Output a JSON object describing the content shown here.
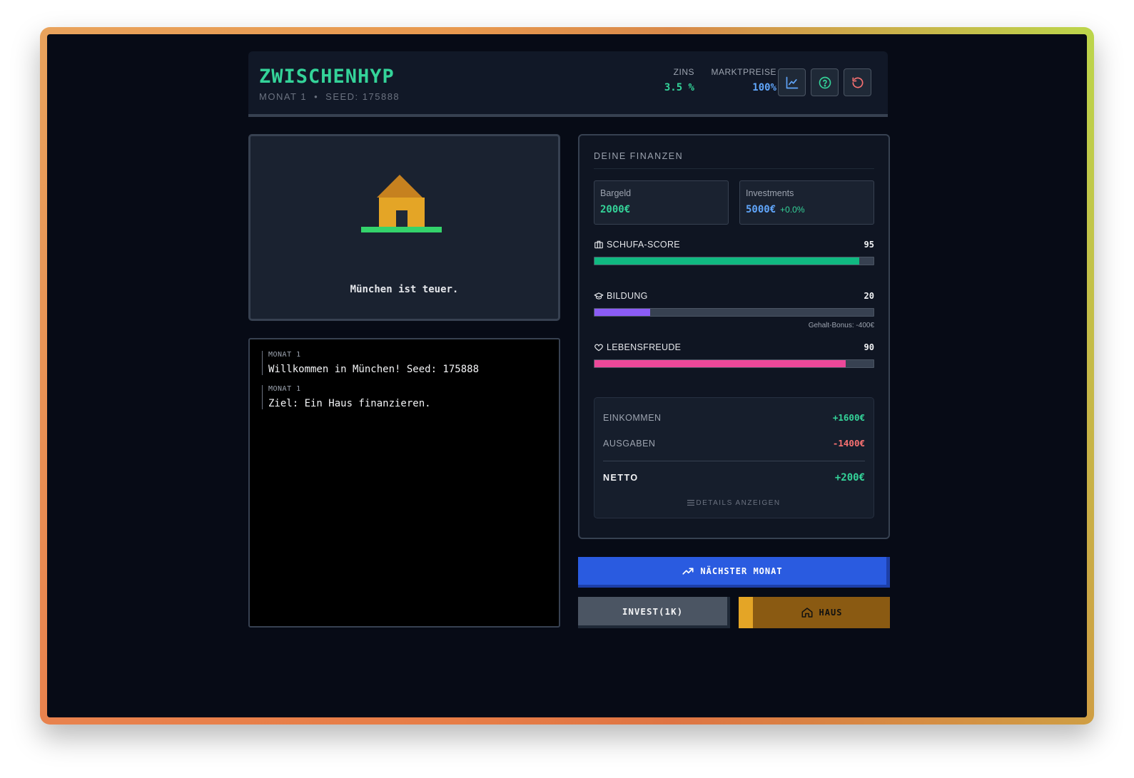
{
  "header": {
    "title": "ZWISCHENHYP",
    "month": "MONAT 1",
    "separator": "•",
    "seed": "SEED: 175888",
    "zins_label": "ZINS",
    "zins_value": "3.5 %",
    "markt_label": "MARKTPREISE",
    "markt_value": "100%",
    "icons": [
      "chart-icon",
      "help-icon",
      "reset-icon"
    ]
  },
  "scene": {
    "caption": "München ist teuer."
  },
  "log": {
    "entries": [
      {
        "month": "MONAT 1",
        "text": "Willkommen in München! Seed: 175888"
      },
      {
        "month": "MONAT 1",
        "text": "Ziel: Ein Haus finanzieren."
      }
    ]
  },
  "finance": {
    "heading": "DEINE FINANZEN",
    "cash_label": "Bargeld",
    "cash_value": "2000€",
    "invest_label": "Investments",
    "invest_value": "5000€",
    "invest_delta": "+0.0%",
    "schufa": {
      "label": "SCHUFA-SCORE",
      "value": "95",
      "fraction": 0.95,
      "color": "#10b981"
    },
    "bildung": {
      "label": "BILDUNG",
      "value": "20",
      "fraction": 0.2,
      "color": "#8b5cf6",
      "note": "Gehalt-Bonus: -400€"
    },
    "lebensfreude": {
      "label": "LEBENSFREUDE",
      "value": "90",
      "fraction": 0.9,
      "color": "#ec4899"
    },
    "income_label": "EINKOMMEN",
    "income_value": "+1600€",
    "expense_label": "AUSGABEN",
    "expense_value": "-1400€",
    "net_label": "NETTO",
    "net_value": "+200€",
    "details_label": "DETAILS ANZEIGEN"
  },
  "actions": {
    "next_label": "NÄCHSTER MONAT",
    "invest_label": "INVEST(1K)",
    "house_label": "HAUS"
  },
  "colors": {
    "accent_green": "#34d399",
    "accent_blue": "#60a5fa",
    "accent_red": "#f87171",
    "button_blue": "#2a5be0",
    "house_gold": "#e4a526"
  }
}
